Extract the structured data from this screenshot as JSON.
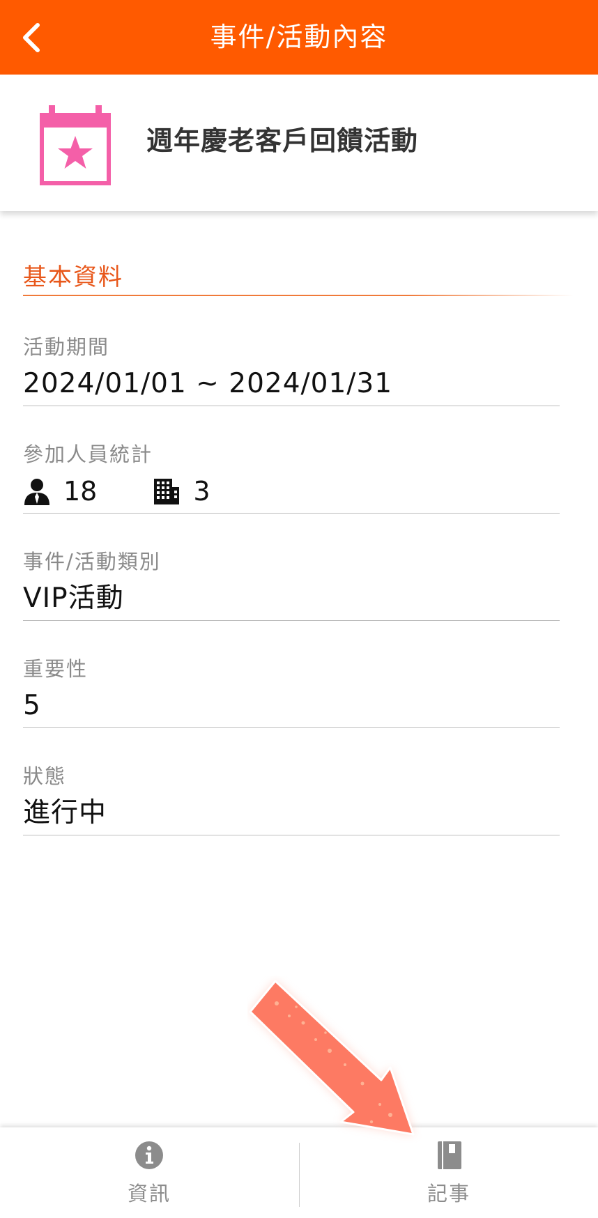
{
  "header": {
    "title": "事件/活動內容",
    "back_icon": "chevron-left-icon"
  },
  "event": {
    "title": "週年慶老客戶回饋活動",
    "icon": "calendar-star-icon"
  },
  "section": {
    "title": "基本資料"
  },
  "fields": {
    "period": {
      "label": "活動期間",
      "value": "2024/01/01 ~ 2024/01/31"
    },
    "participants": {
      "label": "參加人員統計",
      "people_count": "18",
      "company_count": "3",
      "people_icon": "person-icon",
      "company_icon": "building-icon"
    },
    "category": {
      "label": "事件/活動類別",
      "value": "VIP活動"
    },
    "importance": {
      "label": "重要性",
      "value": "5"
    },
    "status": {
      "label": "狀態",
      "value": "進行中"
    }
  },
  "bottom_tabs": [
    {
      "label": "資訊",
      "icon": "info-icon"
    },
    {
      "label": "記事",
      "icon": "notebook-icon"
    }
  ],
  "colors": {
    "accent": "#ff5a00",
    "section": "#e8571a",
    "calendar_icon": "#f45fa8",
    "arrow": "#fd7a63"
  }
}
